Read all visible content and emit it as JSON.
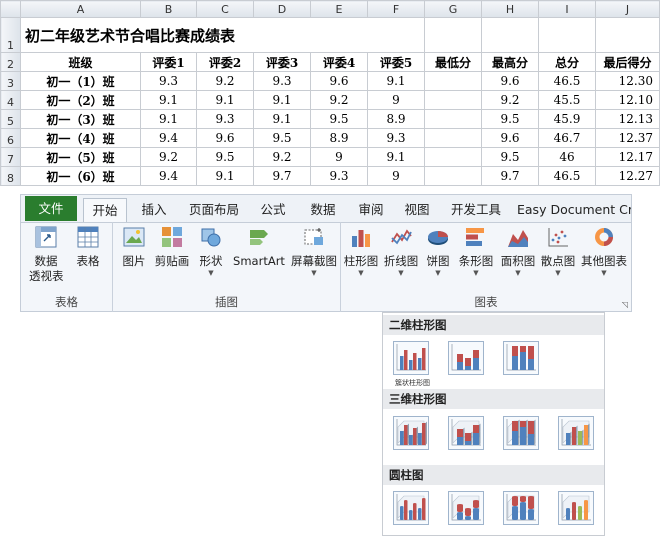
{
  "sheet": {
    "column_headers": [
      "A",
      "B",
      "C",
      "D",
      "E",
      "F",
      "G",
      "H",
      "I",
      "J"
    ],
    "row_numbers": [
      "1",
      "2",
      "3",
      "4",
      "5",
      "6",
      "7",
      "8"
    ],
    "title": "初二年级艺术节合唱比赛成绩表",
    "headers": [
      "班级",
      "评委1",
      "评委2",
      "评委3",
      "评委4",
      "评委5",
      "最低分",
      "最高分",
      "总分",
      "最后得分"
    ],
    "rows": [
      [
        "初一（1）班",
        "9.3",
        "9.2",
        "9.3",
        "9.6",
        "9.1",
        "",
        "9.6",
        "46.5",
        "12.30"
      ],
      [
        "初一（2）班",
        "9.1",
        "9.1",
        "9.1",
        "9.2",
        "9",
        "",
        "9.2",
        "45.5",
        "12.10"
      ],
      [
        "初一（3）班",
        "9.1",
        "9.3",
        "9.1",
        "9.5",
        "8.9",
        "",
        "9.5",
        "45.9",
        "12.13"
      ],
      [
        "初一（4）班",
        "9.4",
        "9.6",
        "9.5",
        "8.9",
        "9.3",
        "",
        "9.6",
        "46.7",
        "12.37"
      ],
      [
        "初一（5）班",
        "9.2",
        "9.5",
        "9.2",
        "9",
        "9.1",
        "",
        "9.5",
        "46",
        "12.17"
      ],
      [
        "初一（6）班",
        "9.4",
        "9.1",
        "9.7",
        "9.3",
        "9",
        "",
        "9.7",
        "46.5",
        "12.27"
      ]
    ]
  },
  "ribbon": {
    "tabs": [
      "文件",
      "开始",
      "插入",
      "页面布局",
      "公式",
      "数据",
      "审阅",
      "视图",
      "开发工具",
      "Easy Document Cr"
    ],
    "active_tab": "开始",
    "groups": {
      "tables": {
        "label": "表格",
        "pivot_line1": "数据",
        "pivot_line2": "透视表",
        "table": "表格"
      },
      "illustrations": {
        "label": "插图",
        "picture": "图片",
        "clipart": "剪贴画",
        "shapes": "形状",
        "smartart": "SmartArt",
        "screenshot": "屏幕截图"
      },
      "charts": {
        "label": "图表",
        "column": "柱形图",
        "line": "折线图",
        "pie": "饼图",
        "bar": "条形图",
        "area": "面积图",
        "scatter": "散点图",
        "other": "其他图表"
      }
    }
  },
  "dropdown": {
    "sections": [
      "二维柱形图",
      "三维柱形图",
      "圆柱图"
    ],
    "caption": "簇状柱形图"
  },
  "colors": {
    "file_tab": "#2a7d2e",
    "chart_blue": "#4f81bd",
    "chart_red": "#c0504d",
    "chart_orange": "#f79646",
    "chart_green": "#9bbb59"
  }
}
